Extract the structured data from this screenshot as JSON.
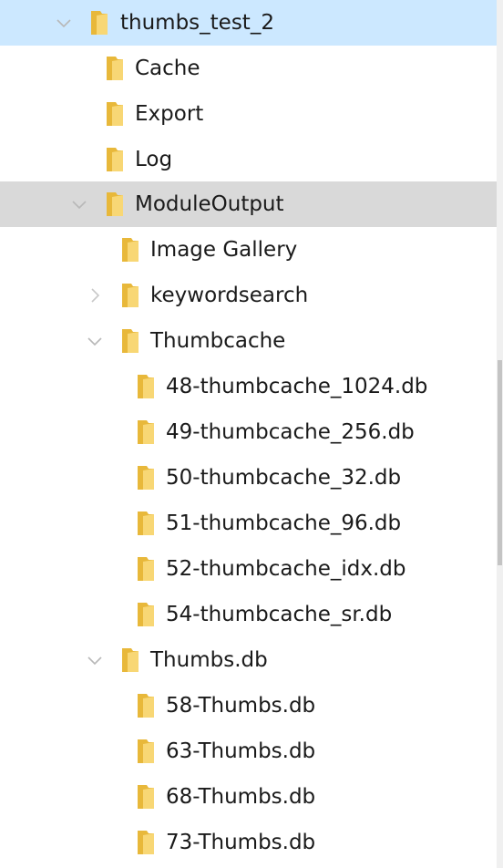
{
  "tree": {
    "items": [
      {
        "label": "thumbs_test_2",
        "state": "expanded",
        "icon": "folder-icon"
      },
      {
        "label": "Cache",
        "state": "none",
        "icon": "folder-icon"
      },
      {
        "label": "Export",
        "state": "none",
        "icon": "folder-icon"
      },
      {
        "label": "Log",
        "state": "none",
        "icon": "folder-icon"
      },
      {
        "label": "ModuleOutput",
        "state": "expanded",
        "icon": "folder-icon"
      },
      {
        "label": "Image Gallery",
        "state": "none",
        "icon": "folder-icon"
      },
      {
        "label": "keywordsearch",
        "state": "collapsed",
        "icon": "folder-icon"
      },
      {
        "label": "Thumbcache",
        "state": "expanded",
        "icon": "folder-icon"
      },
      {
        "label": "48-thumbcache_1024.db",
        "state": "none",
        "icon": "folder-icon"
      },
      {
        "label": "49-thumbcache_256.db",
        "state": "none",
        "icon": "folder-icon"
      },
      {
        "label": "50-thumbcache_32.db",
        "state": "none",
        "icon": "folder-icon"
      },
      {
        "label": "51-thumbcache_96.db",
        "state": "none",
        "icon": "folder-icon"
      },
      {
        "label": "52-thumbcache_idx.db",
        "state": "none",
        "icon": "folder-icon"
      },
      {
        "label": "54-thumbcache_sr.db",
        "state": "none",
        "icon": "folder-icon"
      },
      {
        "label": "Thumbs.db",
        "state": "expanded",
        "icon": "folder-icon"
      },
      {
        "label": "58-Thumbs.db",
        "state": "none",
        "icon": "folder-icon"
      },
      {
        "label": "63-Thumbs.db",
        "state": "none",
        "icon": "folder-icon"
      },
      {
        "label": "68-Thumbs.db",
        "state": "none",
        "icon": "folder-icon"
      },
      {
        "label": "73-Thumbs.db",
        "state": "none",
        "icon": "folder-icon"
      }
    ]
  },
  "colors": {
    "selected_row": "#cce8ff",
    "hovered_row": "#d9d9d9",
    "folder_body": "#f8d775",
    "folder_back": "#e8b83a",
    "chevron": "#b8b8b8",
    "scrollbar_thumb": "#c4c4c4"
  }
}
